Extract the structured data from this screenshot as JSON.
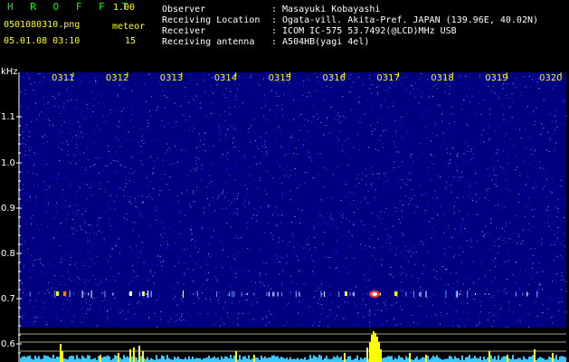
{
  "header": {
    "title": "H R O F F T",
    "version": "1.00",
    "filename": "0501080310.png",
    "meteor_label": "meteor",
    "meteor_count": "15",
    "datetime": "05.01.08 03:10",
    "info": [
      {
        "label": "Observer",
        "value": ": Masayuki Kobayashi"
      },
      {
        "label": "Receiving Location",
        "value": ": Ogata-vill. Akita-Pref. JAPAN (139.96E, 40.02N)"
      },
      {
        "label": "Receiver",
        "value": ": ICOM IC-575 53.7492(@LCD)MHz USB"
      },
      {
        "label": "Receiving antenna",
        "value": ": A504HB(yagi 4el)"
      }
    ]
  },
  "spectrogram": {
    "freq_unit": "kHz",
    "y_ticks": [
      "1.1",
      "1.0",
      "0.9",
      "0.8",
      "0.7",
      "0.6"
    ],
    "time_ticks": [
      "0311",
      "0312",
      "0313",
      "0314",
      "0315",
      "0316",
      "0317",
      "0318",
      "0319",
      "0320"
    ],
    "colors": {
      "background": "#000080",
      "tick_label": "#ffff00",
      "axis": "#ffffff",
      "signal": "#ffff00",
      "noise": "#3cc8ff"
    }
  }
}
